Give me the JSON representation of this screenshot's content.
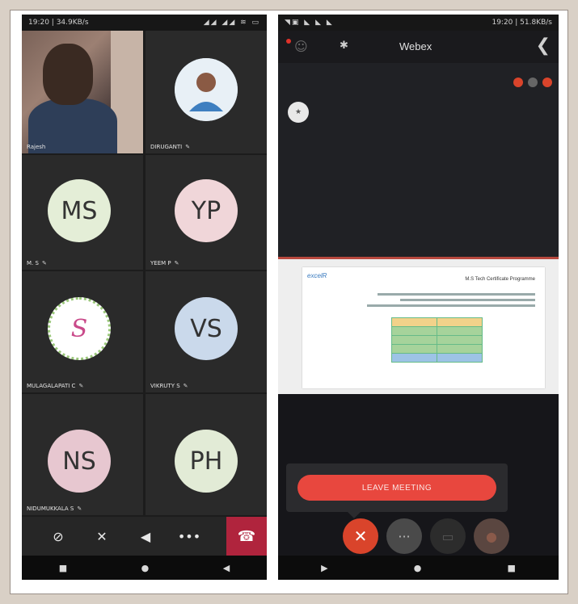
{
  "left_phone": {
    "status": {
      "time": "19:20 | 34.9KB/s",
      "icons": "◢◢ ◢◢ ≋ ▭"
    },
    "participants": [
      {
        "kind": "video",
        "name": "Rajesh",
        "muted": false
      },
      {
        "kind": "photo",
        "name": "DIRUGANTI",
        "muted": true
      },
      {
        "kind": "initials",
        "initials": "MS",
        "name": "M. S",
        "color": "#e4eed7",
        "muted": true
      },
      {
        "kind": "initials",
        "initials": "YP",
        "name": "YEEM P",
        "color": "#f0d6d9",
        "muted": true
      },
      {
        "kind": "logo",
        "initials": "S",
        "name": "MULAGALAPATI C",
        "color": "#ffffff",
        "muted": true
      },
      {
        "kind": "initials",
        "initials": "VS",
        "name": "VIKRUTY S",
        "color": "#cad9eb",
        "muted": true
      },
      {
        "kind": "initials",
        "initials": "NS",
        "name": "NIDUMUKKALA S",
        "color": "#e7c7d0",
        "muted": true
      },
      {
        "kind": "initials",
        "initials": "PH",
        "name": "",
        "color": "#e2ebd6",
        "muted": false
      }
    ],
    "controls": {
      "video_off_icon": "⊘",
      "mic_off_icon": "✕",
      "speaker_icon": "◀",
      "more_icon": "•••",
      "end_call_icon": "☎"
    },
    "nav": {
      "recents": "■",
      "home": "●",
      "back": "◀"
    }
  },
  "right_phone": {
    "status": {
      "time": "19:20 | 51.8KB/s",
      "icons": "◥▣ ◣ ◣ ◣"
    },
    "header": {
      "title": "Webex",
      "user_icon": "☺",
      "bt_icon": "✱",
      "back_icon": "❮"
    },
    "self_label": "★",
    "badge_colors": [
      "#d9442b",
      "#666666",
      "#d9442b"
    ],
    "slide": {
      "logo": "excelR",
      "heading": "M.S Tech Certificate Programme"
    },
    "leave_button": "LEAVE MEETING",
    "controls": {
      "close_icon": "✕",
      "more_icon": "···",
      "share_icon": "▭",
      "mute_icon": "●"
    },
    "nav": {
      "back": "▶",
      "home": "●",
      "recents": "■"
    }
  }
}
